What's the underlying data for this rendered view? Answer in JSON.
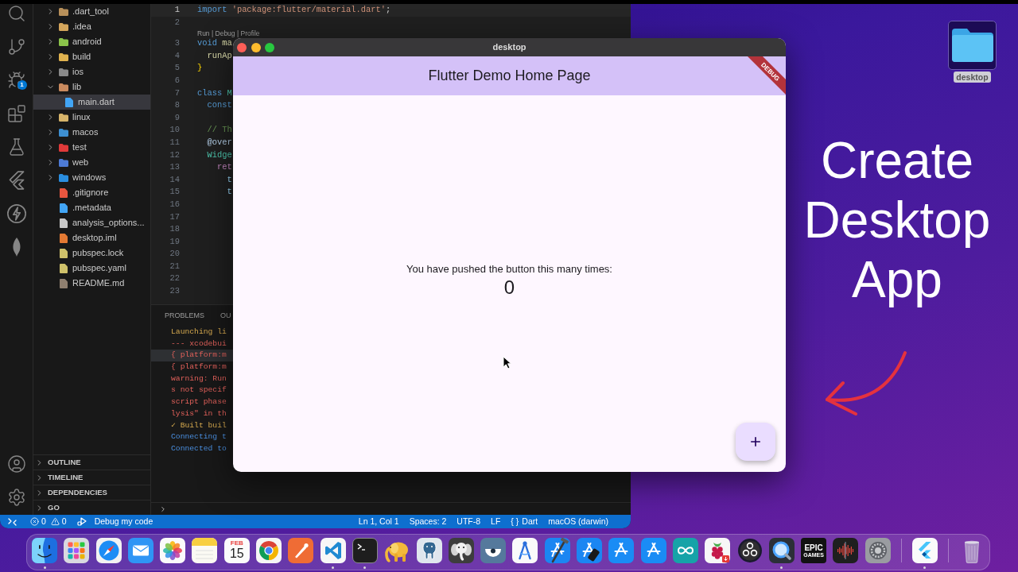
{
  "activity_bar": {
    "top": [
      {
        "kind": "search"
      },
      {
        "kind": "source_control"
      },
      {
        "kind": "run_debug",
        "badge": "1"
      },
      {
        "kind": "extensions"
      },
      {
        "kind": "testing"
      },
      {
        "kind": "flutter"
      },
      {
        "kind": "lightning"
      },
      {
        "kind": "leaf"
      }
    ],
    "bottom": [
      {
        "kind": "account"
      },
      {
        "kind": "settings"
      }
    ]
  },
  "explorer": {
    "tree": [
      {
        "name": ".dart_tool",
        "kind": "folder",
        "color": "#b8905a",
        "expanded": false,
        "selected": false
      },
      {
        "name": ".idea",
        "kind": "folder",
        "color": "#d4a55b",
        "expanded": false,
        "selected": false
      },
      {
        "name": "android",
        "kind": "folder",
        "color": "#8bc34a",
        "expanded": false,
        "selected": false
      },
      {
        "name": "build",
        "kind": "folder",
        "color": "#e0b24f",
        "expanded": false,
        "selected": false
      },
      {
        "name": "ios",
        "kind": "folder",
        "color": "#8a8a8a",
        "expanded": false,
        "selected": false
      },
      {
        "name": "lib",
        "kind": "folder",
        "color": "#c98a5e",
        "expanded": true,
        "selected": false,
        "children": [
          {
            "name": "main.dart",
            "kind": "file",
            "color": "#42a5f5",
            "selected": true
          }
        ]
      },
      {
        "name": "linux",
        "kind": "folder",
        "color": "#d7b46a",
        "expanded": false,
        "selected": false
      },
      {
        "name": "macos",
        "kind": "folder",
        "color": "#3d8fd1",
        "expanded": false,
        "selected": false
      },
      {
        "name": "test",
        "kind": "folder",
        "color": "#e03a3a",
        "expanded": false,
        "selected": false
      },
      {
        "name": "web",
        "kind": "folder",
        "color": "#4d7bd6",
        "expanded": false,
        "selected": false
      },
      {
        "name": "windows",
        "kind": "folder",
        "color": "#2a8ee0",
        "expanded": false,
        "selected": false
      },
      {
        "name": ".gitignore",
        "kind": "file",
        "color": "#e8563f",
        "selected": false
      },
      {
        "name": ".metadata",
        "kind": "file",
        "color": "#42a5f5",
        "selected": false
      },
      {
        "name": "analysis_options...",
        "kind": "file",
        "color": "#c7c7c7",
        "selected": false
      },
      {
        "name": "desktop.iml",
        "kind": "file",
        "color": "#e37933",
        "selected": false
      },
      {
        "name": "pubspec.lock",
        "kind": "file",
        "color": "#cfc16a",
        "selected": false
      },
      {
        "name": "pubspec.yaml",
        "kind": "file",
        "color": "#cfc16a",
        "selected": false
      },
      {
        "name": "README.md",
        "kind": "file",
        "color": "#8f7f6f",
        "selected": false
      }
    ],
    "sections": [
      {
        "label": "OUTLINE",
        "expanded": false
      },
      {
        "label": "TIMELINE",
        "expanded": false
      },
      {
        "label": "DEPENDENCIES",
        "expanded": false
      },
      {
        "label": "GO",
        "expanded": false
      }
    ]
  },
  "editor": {
    "lines": [
      {
        "kind": "code",
        "number": "1",
        "current": true,
        "tokens": [
          {
            "text": "import",
            "kind": "keyword"
          },
          {
            "text": " 'package:flutter/material.dart'",
            "kind": "string"
          },
          {
            "text": ";",
            "kind": "plain"
          }
        ]
      },
      {
        "kind": "code",
        "number": "2",
        "current": false
      },
      {
        "kind": "lens",
        "text": "Run | Debug | Profile"
      },
      {
        "kind": "code",
        "number": "3",
        "current": false,
        "tokens": [
          {
            "text": "void",
            "kind": "keyword"
          },
          {
            "text": " ma",
            "kind": "function"
          }
        ]
      },
      {
        "kind": "code",
        "number": "4",
        "current": false,
        "tokens": [
          {
            "text": "  runAp",
            "kind": "function"
          }
        ]
      },
      {
        "kind": "code",
        "number": "5",
        "current": false,
        "tokens": [
          {
            "text": "}",
            "kind": "bracket"
          }
        ]
      },
      {
        "kind": "code",
        "number": "6",
        "current": false
      },
      {
        "kind": "code",
        "number": "7",
        "current": false,
        "tokens": [
          {
            "text": "class",
            "kind": "keyword"
          },
          {
            "text": " M",
            "kind": "type"
          }
        ]
      },
      {
        "kind": "code",
        "number": "8",
        "current": false,
        "tokens": [
          {
            "text": "  const",
            "kind": "keyword"
          }
        ]
      },
      {
        "kind": "code",
        "number": "9",
        "current": false
      },
      {
        "kind": "code",
        "number": "10",
        "current": false,
        "tokens": [
          {
            "text": "  // Th",
            "kind": "comment"
          }
        ]
      },
      {
        "kind": "code",
        "number": "11",
        "current": false,
        "tokens": [
          {
            "text": "  @over",
            "kind": "annotation"
          }
        ]
      },
      {
        "kind": "code",
        "number": "12",
        "current": false,
        "tokens": [
          {
            "text": "  Widge",
            "kind": "type"
          }
        ]
      },
      {
        "kind": "code",
        "number": "13",
        "current": false,
        "tokens": [
          {
            "text": "    ret",
            "kind": "control"
          }
        ]
      },
      {
        "kind": "code",
        "number": "14",
        "current": false,
        "tokens": [
          {
            "text": "      t",
            "kind": "variable"
          }
        ]
      },
      {
        "kind": "code",
        "number": "15",
        "current": false,
        "tokens": [
          {
            "text": "      t",
            "kind": "variable"
          }
        ]
      },
      {
        "kind": "code",
        "number": "16",
        "current": false
      },
      {
        "kind": "code",
        "number": "17",
        "current": false
      },
      {
        "kind": "code",
        "number": "18",
        "current": false
      },
      {
        "kind": "code",
        "number": "19",
        "current": false
      },
      {
        "kind": "code",
        "number": "20",
        "current": false
      },
      {
        "kind": "code",
        "number": "21",
        "current": false
      },
      {
        "kind": "code",
        "number": "22",
        "current": false
      },
      {
        "kind": "code",
        "number": "23",
        "current": false
      }
    ]
  },
  "panel": {
    "tabs": [
      "PROBLEMS",
      "OU"
    ],
    "output": [
      {
        "text": "Launching li",
        "kind": "info",
        "selected": false
      },
      {
        "text": "--- xcodebui",
        "kind": "error",
        "selected": false
      },
      {
        "text": "{ platform:m",
        "kind": "error",
        "selected": true
      },
      {
        "text": "{ platform:m",
        "kind": "error",
        "selected": false
      },
      {
        "text": "warning: Run",
        "kind": "error",
        "selected": false
      },
      {
        "text": "s not specif",
        "kind": "error",
        "selected": false
      },
      {
        "text": "script phase",
        "kind": "error",
        "selected": false
      },
      {
        "text": "lysis\" in th",
        "kind": "error",
        "selected": false
      },
      {
        "text": "✓ Built buil",
        "kind": "info",
        "selected": false
      },
      {
        "text": "Connecting t",
        "kind": "status",
        "selected": false
      },
      {
        "text": "Connected to",
        "kind": "status",
        "selected": false
      }
    ]
  },
  "status_bar": {
    "errors": "0",
    "warnings": "0",
    "debug_label": "Debug my code",
    "right": [
      {
        "text": "Ln 1, Col 1"
      },
      {
        "text": "Spaces: 2"
      },
      {
        "text": "UTF-8"
      },
      {
        "text": "LF"
      },
      {
        "glyph": "{ }",
        "text": "Dart"
      },
      {
        "text": "macOS (darwin)"
      }
    ]
  },
  "app_window": {
    "title": "desktop",
    "app_bar_title": "Flutter Demo Home Page",
    "debug_banner": "DEBUG",
    "message": "You have pushed the button this many times:",
    "counter": "0"
  },
  "desktop": {
    "headline": "Create Desktop App",
    "folder": {
      "label": "desktop",
      "selected": true
    }
  },
  "dock": {
    "sections": [
      [
        {
          "kind": "finder",
          "running": true
        },
        {
          "kind": "launchpad",
          "running": false
        },
        {
          "kind": "safari",
          "running": false
        },
        {
          "kind": "mail",
          "running": false
        },
        {
          "kind": "photos",
          "running": false
        },
        {
          "kind": "notes",
          "running": false
        },
        {
          "kind": "calendar",
          "running": false,
          "month": "FEB",
          "day": "15"
        },
        {
          "kind": "chrome",
          "running": false
        },
        {
          "kind": "postman",
          "running": false
        },
        {
          "kind": "vscode",
          "running": true
        },
        {
          "kind": "terminal",
          "running": true
        },
        {
          "kind": "elephant",
          "running": false
        },
        {
          "kind": "postgres",
          "running": false
        },
        {
          "kind": "mammoth",
          "running": false
        },
        {
          "kind": "eye",
          "running": false
        },
        {
          "kind": "compass",
          "running": false
        },
        {
          "kind": "xcode",
          "running": false
        },
        {
          "kind": "simulator",
          "running": false
        },
        {
          "kind": "appstore",
          "running": false
        },
        {
          "kind": "appstore",
          "running": false
        },
        {
          "kind": "arduino",
          "running": false
        },
        {
          "kind": "raspberry",
          "running": false
        },
        {
          "kind": "obs",
          "running": false
        },
        {
          "kind": "quicktime",
          "running": true
        },
        {
          "kind": "epic",
          "running": false,
          "wordmark": [
            "EPIC",
            "GAMES"
          ]
        },
        {
          "kind": "waveform",
          "running": false
        },
        {
          "kind": "settings",
          "running": false
        }
      ],
      [
        {
          "kind": "flutter",
          "running": true
        }
      ],
      [
        {
          "kind": "trash",
          "running": false
        }
      ]
    ]
  }
}
